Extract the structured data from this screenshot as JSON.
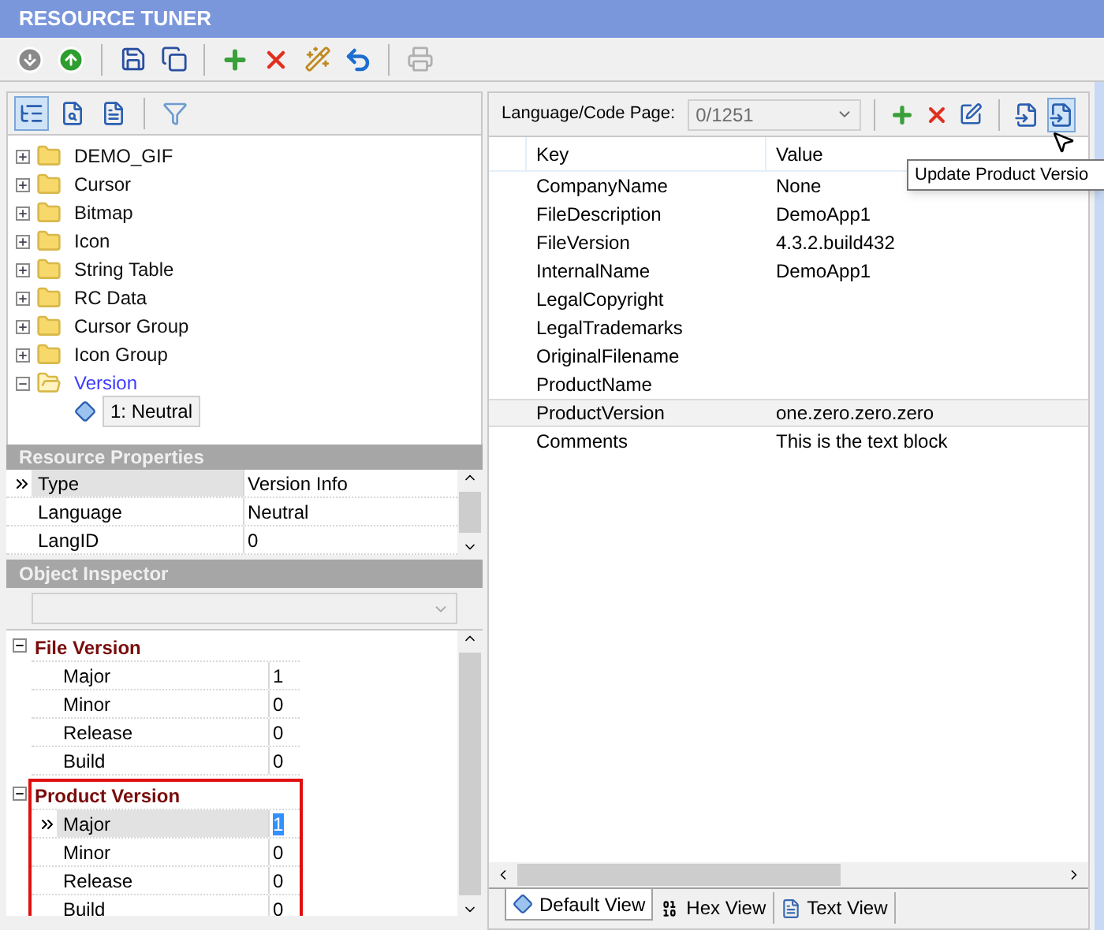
{
  "window": {
    "title": "RESOURCE TUNER"
  },
  "tree": [
    {
      "label": "DEMO_GIF",
      "expanded": false
    },
    {
      "label": "Cursor",
      "expanded": false
    },
    {
      "label": "Bitmap",
      "expanded": false
    },
    {
      "label": "Icon",
      "expanded": false
    },
    {
      "label": "String Table",
      "expanded": false
    },
    {
      "label": "RC Data",
      "expanded": false
    },
    {
      "label": "Cursor Group",
      "expanded": false
    },
    {
      "label": "Icon Group",
      "expanded": false
    },
    {
      "label": "Version",
      "expanded": true,
      "children": [
        {
          "label": "1: Neutral",
          "selected": true
        }
      ]
    }
  ],
  "resource_properties": {
    "title": "Resource Properties",
    "rows": [
      {
        "key": "Type",
        "value": "Version Info",
        "selected": true
      },
      {
        "key": "Language",
        "value": "Neutral",
        "selected": false
      },
      {
        "key": "LangID",
        "value": "0",
        "selected": false
      }
    ]
  },
  "object_inspector": {
    "title": "Object Inspector",
    "groups": [
      {
        "title": "File Version",
        "expanded": true,
        "highlighted": false,
        "rows": [
          {
            "key": "Major",
            "value": "1",
            "selected": false
          },
          {
            "key": "Minor",
            "value": "0",
            "selected": false
          },
          {
            "key": "Release",
            "value": "0",
            "selected": false
          },
          {
            "key": "Build",
            "value": "0",
            "selected": false
          }
        ]
      },
      {
        "title": "Product Version",
        "expanded": true,
        "highlighted": true,
        "rows": [
          {
            "key": "Major",
            "value": "1",
            "selected": true
          },
          {
            "key": "Minor",
            "value": "0",
            "selected": false
          },
          {
            "key": "Release",
            "value": "0",
            "selected": false
          },
          {
            "key": "Build",
            "value": "0",
            "selected": false
          }
        ]
      }
    ]
  },
  "code_page": {
    "label": "Language/Code Page:",
    "value": "0/1251",
    "disabled": true
  },
  "table": {
    "columns": [
      "Key",
      "Value"
    ],
    "rows": [
      {
        "key": "CompanyName",
        "value": "None",
        "selected": false
      },
      {
        "key": "FileDescription",
        "value": "DemoApp1",
        "selected": false
      },
      {
        "key": "FileVersion",
        "value": "4.3.2.build432",
        "selected": false
      },
      {
        "key": "InternalName",
        "value": "DemoApp1",
        "selected": false
      },
      {
        "key": "LegalCopyright",
        "selected": false
      },
      {
        "key": "LegalTrademarks",
        "selected": false
      },
      {
        "key": "OriginalFilename",
        "selected": false
      },
      {
        "key": "ProductName",
        "selected": false
      },
      {
        "key": "ProductVersion",
        "value": "one.zero.zero.zero",
        "selected": true
      },
      {
        "key": "Comments",
        "value": "This is the text block",
        "selected": false
      }
    ]
  },
  "tooltip": "Update Product Versio",
  "tabs": [
    {
      "label": "Default View",
      "kind": "default",
      "selected": true
    },
    {
      "label": "Hex View",
      "kind": "hex",
      "selected": false
    },
    {
      "label": "Text View",
      "kind": "text",
      "selected": false
    }
  ]
}
